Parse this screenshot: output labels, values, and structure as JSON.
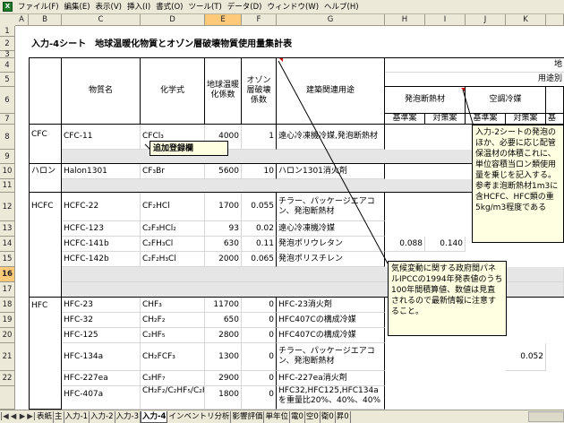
{
  "app": {
    "icon": "excel-icon"
  },
  "menu": [
    "ファイル(F)",
    "編集(E)",
    "表示(V)",
    "挿入(I)",
    "書式(O)",
    "ツール(T)",
    "データ(D)",
    "ウィンドウ(W)",
    "ヘルプ(H)"
  ],
  "columns": [
    "A",
    "B",
    "C",
    "D",
    "E",
    "F",
    "G",
    "H",
    "I",
    "J",
    "K"
  ],
  "rows": [
    "1",
    "2",
    "3",
    "4",
    "5",
    "6",
    "7",
    "8",
    "9",
    "10",
    "11",
    "12",
    "13",
    "14",
    "15",
    "16",
    "17",
    "18",
    "19",
    "20",
    "21",
    "22"
  ],
  "selected_row": "16",
  "selected_col": "E",
  "sheet": {
    "title": "入力-4シート　地球温暖化物質とオゾン層破壊物質使用量集計表",
    "hdr_substance": "物質名",
    "hdr_formula": "化学式",
    "hdr_gwp": "地球温暖化係数",
    "hdr_odp": "オゾン層破壊係数",
    "hdr_usage": "建築関連用途",
    "hdr_top_right": "地",
    "hdr_usage_right": "用途別",
    "hdr_foam": "発泡断熱材",
    "hdr_aircon": "空調冷媒",
    "hdr_base1": "基準案",
    "hdr_measure1": "対策案",
    "hdr_base2": "基準案",
    "hdr_measure2": "対策案",
    "hdr_base3": "基",
    "group_cfc": "CFC",
    "group_halon": "ハロン",
    "group_hcfc": "HCFC",
    "group_hfc": "HFC",
    "r8": {
      "name": "CFC-11",
      "formula": "CFCl₃",
      "gwp": "4000",
      "odp": "1",
      "use": "遠心冷凍機冷媒,発泡断熱材"
    },
    "r10": {
      "name": "Halon1301",
      "formula": "CF₃Br",
      "gwp": "5600",
      "odp": "10",
      "use": "ハロン1301消火剤"
    },
    "r12": {
      "name": "HCFC-22",
      "formula": "CF₂HCl",
      "gwp": "1700",
      "odp": "0.055",
      "use": "チラー、パッケージエアコン、発泡断熱材"
    },
    "r13": {
      "name": "HCFC-123",
      "formula": "C₂F₃HCl₂",
      "gwp": "93",
      "odp": "0.02",
      "use": "遠心冷凍機冷媒"
    },
    "r14": {
      "name": "HCFC-141b",
      "formula": "C₂FH₃Cl",
      "gwp": "630",
      "odp": "0.11",
      "use": "発泡ポリウレタン",
      "h": "0.088",
      "i": "0.140"
    },
    "r15": {
      "name": "HCFC-142b",
      "formula": "C₂F₂H₃Cl",
      "gwp": "2000",
      "odp": "0.065",
      "use": "発泡ポリスチレン"
    },
    "r18": {
      "name": "HFC-23",
      "formula": "CHF₃",
      "gwp": "11700",
      "odp": "0",
      "use": "HFC-23消火剤"
    },
    "r19": {
      "name": "HFC-32",
      "formula": "CH₂F₂",
      "gwp": "650",
      "odp": "0",
      "use": "HFC407Cの構成冷媒"
    },
    "r20": {
      "name": "HFC-125",
      "formula": "C₂HF₅",
      "gwp": "2800",
      "odp": "0",
      "use": "HFC407Cの構成冷媒"
    },
    "r21": {
      "name": "HFC-134a",
      "formula": "CH₂FCF₃",
      "gwp": "1300",
      "odp": "0",
      "use": "チラー、パッケージエアコン、発泡断熱材",
      "k": "0.052"
    },
    "r22": {
      "name": "HFC-227ea",
      "formula": "C₃HF₇",
      "gwp": "2900",
      "odp": "0",
      "use": "HFC-227ea消火剤"
    },
    "r23": {
      "name": "HFC-407a",
      "formula": "CH₂F₂/C₂HF₅/C₂H₂F₄",
      "gwp": "1800",
      "odp": "0",
      "use": "HFC32,HFC125,HFC134aを重量比20%、40%、40%"
    }
  },
  "comments": {
    "add_field": "追加登録欄",
    "ipcc": "気候変動に関する政府間パネルIPCCの1994年発表値のうち100年間積算値、数値は見直されるので最新情報に注意すること。",
    "input2": "入力-2シートの発泡のほか、必要に応じ配管保温材の体積これに、単位容積当ロン類使用量を乗じを記入する。参考ま泡断熱材1m3に含HCFC、HFC類の重5kg/m3程度である"
  },
  "tabs": [
    "表紙",
    "主",
    "入力-1",
    "入力-2",
    "入力-3",
    "入力-4",
    "インベントリ分析",
    "影響評価",
    "単年位",
    "電0",
    "空0",
    "衛0",
    "昇0"
  ],
  "active_tab": "入力-4"
}
